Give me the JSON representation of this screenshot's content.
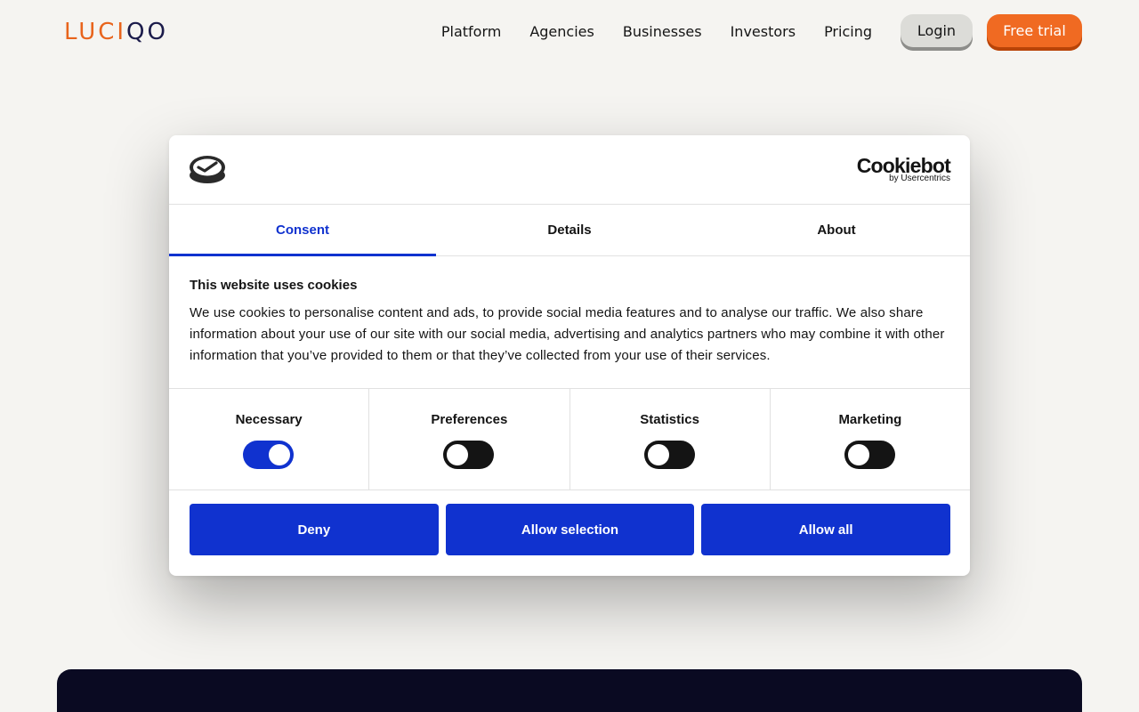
{
  "header": {
    "logo_text_a": "LUCI",
    "logo_text_b": "QO",
    "nav": [
      "Platform",
      "Agencies",
      "Businesses",
      "Investors",
      "Pricing"
    ],
    "login_label": "Login",
    "trial_label": "Free trial"
  },
  "colors": {
    "brand_orange": "#f06a22",
    "brand_navy": "#1b1b4a",
    "cookie_accent": "#1032cf",
    "page_bg": "#f5f4f1"
  },
  "cookie_dialog": {
    "brand_name": "Cookiebot",
    "brand_sub": "by Usercentrics",
    "tabs": [
      {
        "label": "Consent",
        "active": true
      },
      {
        "label": "Details",
        "active": false
      },
      {
        "label": "About",
        "active": false
      }
    ],
    "title": "This website uses cookies",
    "text": "We use cookies to personalise content and ads, to provide social media features and to analyse our traffic. We also share information about your use of our site with our social media, advertising and analytics partners who may combine it with other information that you’ve provided to them or that they’ve collected from your use of their services.",
    "toggles": [
      {
        "label": "Necessary",
        "on": true
      },
      {
        "label": "Preferences",
        "on": false
      },
      {
        "label": "Statistics",
        "on": false
      },
      {
        "label": "Marketing",
        "on": false
      }
    ],
    "buttons": {
      "deny": "Deny",
      "allow_selection": "Allow selection",
      "allow_all": "Allow all"
    }
  }
}
